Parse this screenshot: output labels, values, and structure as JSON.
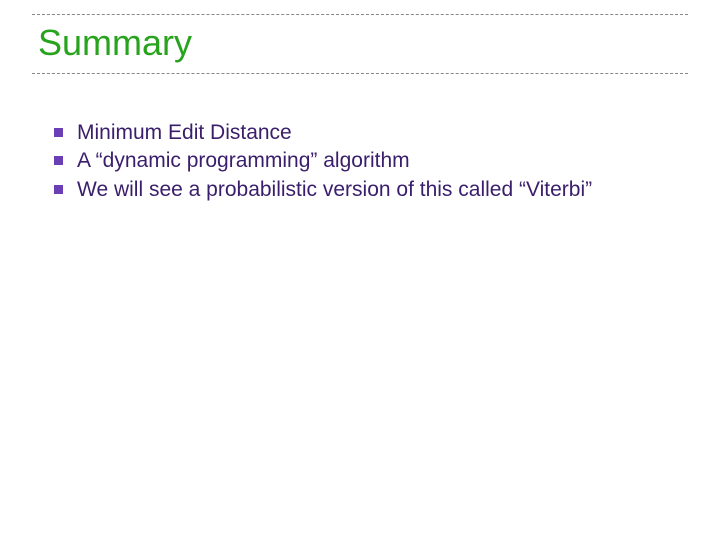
{
  "title": "Summary",
  "bullets": [
    {
      "text": "Minimum Edit Distance"
    },
    {
      "text": "A “dynamic programming” algorithm"
    },
    {
      "text": "We will see a probabilistic version of this called “Viterbi”"
    }
  ]
}
